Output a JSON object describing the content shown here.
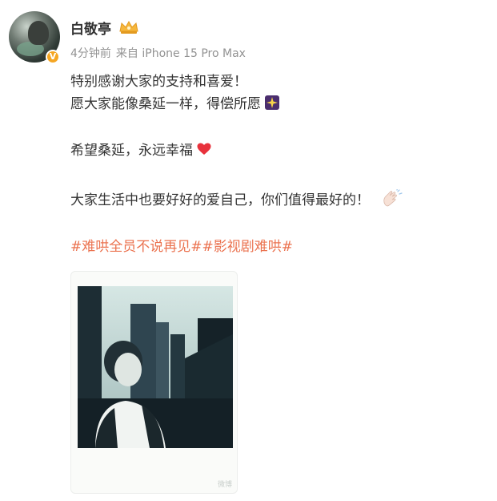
{
  "user": {
    "name": "白敬亭",
    "verified_badge": "V",
    "badge_icon": "crown-icon"
  },
  "meta": {
    "time": "4分钟前",
    "source": "来自 iPhone 15 Pro Max"
  },
  "post": {
    "line1": "特别感谢大家的支持和喜爱！",
    "line2": "愿大家能像桑延一样，得偿所愿",
    "line2_emoji": "sparkle-icon",
    "line3": "希望桑延，永远幸福",
    "line3_emoji": "heart-icon",
    "line4": "大家生活中也要好好的爱自己，你们值得最好的！",
    "line4_emoji": "clap-icon",
    "tags": [
      "#难哄全员不说再见#",
      "#影视剧难哄#"
    ]
  },
  "media": {
    "image": "polaroid-photo",
    "watermark": "微博"
  },
  "colors": {
    "text": "#333333",
    "meta": "#939393",
    "tag": "#eb7350",
    "badge": "#f5a623"
  }
}
